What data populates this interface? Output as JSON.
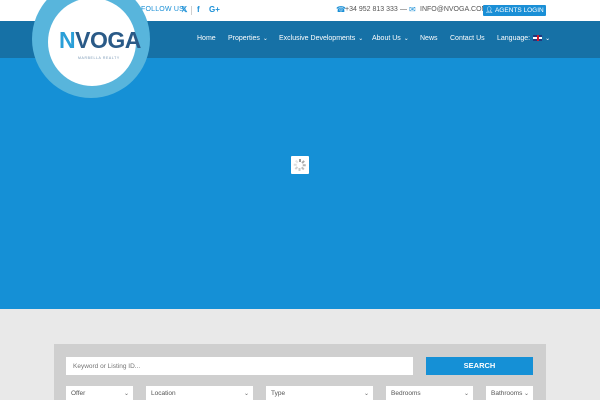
{
  "topbar": {
    "follow_text": "FOLLOW US!",
    "social_icons": [
      "twitter-icon",
      "facebook-icon",
      "google-plus-icon"
    ],
    "phone": "+34 952 813 333",
    "phone_separator": "—",
    "email": "INFO@NVOGA.COM",
    "agents_login": "AGENTS LOGIN"
  },
  "logo": {
    "brand_initial": "N",
    "brand_rest": "VOGA",
    "tagline": "MARBELLA REALTY"
  },
  "nav": {
    "items": [
      {
        "label": "Home",
        "has_dropdown": false
      },
      {
        "label": "Properties",
        "has_dropdown": true
      },
      {
        "label": "Exclusive Developments",
        "has_dropdown": true
      },
      {
        "label": "About Us",
        "has_dropdown": true
      },
      {
        "label": "News",
        "has_dropdown": false
      },
      {
        "label": "Contact Us",
        "has_dropdown": false
      }
    ],
    "language_label": "Language:",
    "language_flag": "uk-flag-icon"
  },
  "search": {
    "placeholder": "Keyword or Listing ID...",
    "button_label": "SEARCH",
    "filters": [
      {
        "label": "Offer"
      },
      {
        "label": "Location"
      },
      {
        "label": "Type"
      },
      {
        "label": "Bedrooms"
      },
      {
        "label": "Bathrooms"
      }
    ]
  },
  "colors": {
    "accent": "#1590d6",
    "nav_bg": "#1671a6",
    "logo_ring": "#58b5dc",
    "logo_text": "#2a5a87"
  }
}
